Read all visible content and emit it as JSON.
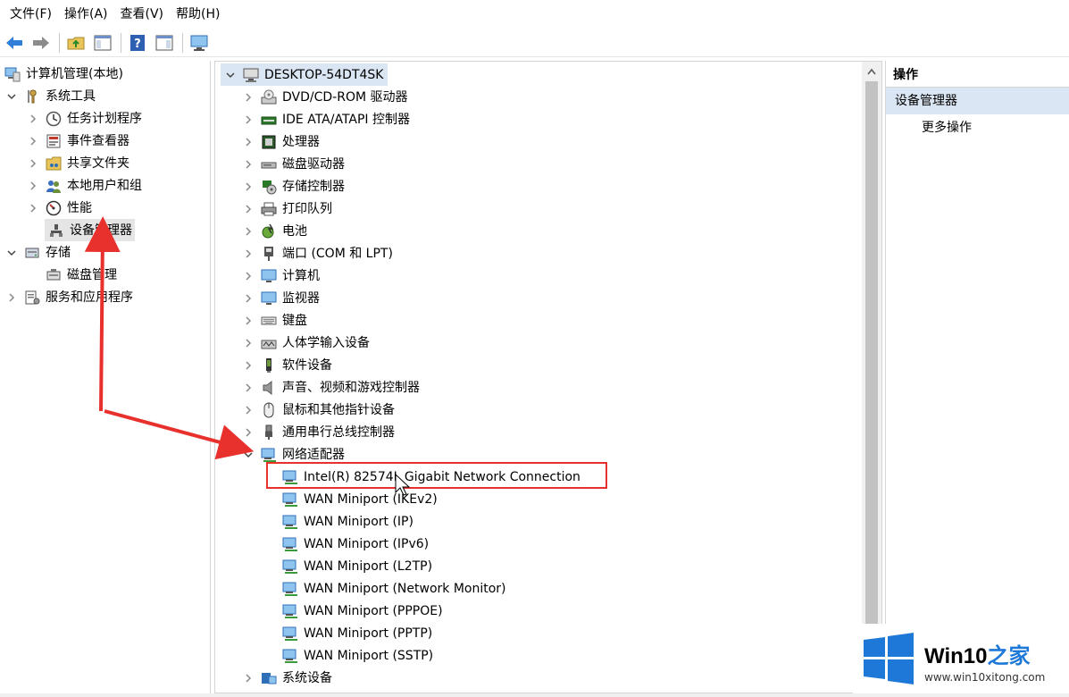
{
  "menu": [
    "文件(F)",
    "操作(A)",
    "查看(V)",
    "帮助(H)"
  ],
  "left_tree": {
    "root": "计算机管理(本地)",
    "system_tools": "系统工具",
    "task_scheduler": "任务计划程序",
    "event_viewer": "事件查看器",
    "shared_folders": "共享文件夹",
    "local_users": "本地用户和组",
    "performance": "性能",
    "device_manager": "设备管理器",
    "storage": "存储",
    "disk_management": "磁盘管理",
    "services_apps": "服务和应用程序"
  },
  "device_tree": {
    "computer": "DESKTOP-54DT4SK",
    "categories": [
      "DVD/CD-ROM 驱动器",
      "IDE ATA/ATAPI 控制器",
      "处理器",
      "磁盘驱动器",
      "存储控制器",
      "打印队列",
      "电池",
      "端口 (COM 和 LPT)",
      "计算机",
      "监视器",
      "键盘",
      "人体学输入设备",
      "软件设备",
      "声音、视频和游戏控制器",
      "鼠标和其他指针设备",
      "通用串行总线控制器",
      "网络适配器"
    ],
    "network_adapters": [
      "Intel(R) 82574L Gigabit Network Connection",
      "WAN Miniport (IKEv2)",
      "WAN Miniport (IP)",
      "WAN Miniport (IPv6)",
      "WAN Miniport (L2TP)",
      "WAN Miniport (Network Monitor)",
      "WAN Miniport (PPPOE)",
      "WAN Miniport (PPTP)",
      "WAN Miniport (SSTP)"
    ],
    "system_devices": "系统设备"
  },
  "actions": {
    "header": "操作",
    "section": "设备管理器",
    "more": "更多操作"
  },
  "watermark": {
    "brand": "Win10",
    "suffix": "之家",
    "url": "www.win10xitong.com"
  },
  "colors": {
    "annotation_red": "#e8312d",
    "selection_blue": "#dbe6f4",
    "win_blue": "#1e78d7"
  }
}
